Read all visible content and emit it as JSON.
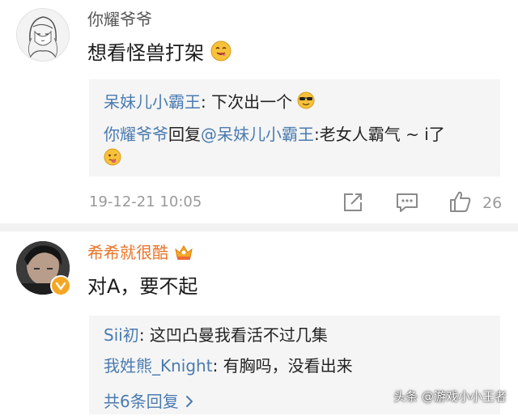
{
  "comments": [
    {
      "username": "你耀爷爷",
      "text": "想看怪兽打架",
      "text_emoji": "yum-emoji",
      "replies": [
        {
          "author": "呆妹儿小霸王",
          "separator": ": ",
          "text": "下次出一个",
          "emoji": "sunglasses-emoji"
        },
        {
          "author": "你耀爷爷",
          "reply_word": "回复",
          "mention": "@呆妹儿小霸王",
          "separator": ":",
          "text": "老女人霸气 ~ i了",
          "emoji": "tongue-emoji"
        }
      ],
      "timestamp": "19-12-21 10:05",
      "like_count": "26"
    },
    {
      "username": "希希就很酷",
      "text": "对A，要不起",
      "replies": [
        {
          "author": "Sii初",
          "separator": ": ",
          "text": "这凹凸曼我看活不过几集"
        },
        {
          "author": "我姓熊_Knight",
          "separator": ": ",
          "text": "有胸吗，没看出来"
        }
      ],
      "more_replies": "共6条回复"
    }
  ],
  "watermark": "头条 @游戏小小王者",
  "colors": {
    "link": "#4a7bb0",
    "vip_name": "#e8742a",
    "reply_bg": "#f5f5f5",
    "meta": "#9a9a9a"
  }
}
